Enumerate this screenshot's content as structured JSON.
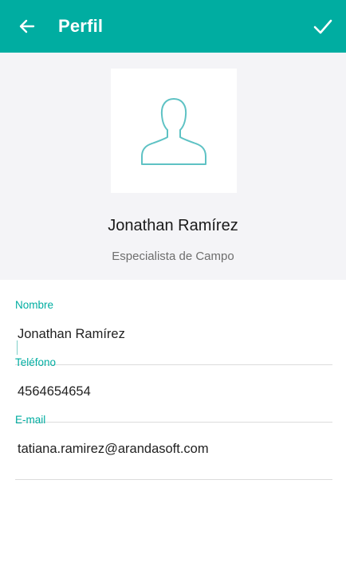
{
  "app_bar": {
    "title": "Perfil",
    "back_icon": "arrow-left-icon",
    "save_icon": "check-icon",
    "color": "#00ADA1"
  },
  "profile": {
    "avatar_icon": "user-silhouette-icon",
    "name": "Jonathan Ramírez",
    "role": "Especialista de Campo"
  },
  "form": {
    "nombre": {
      "label": "Nombre",
      "value": "Jonathan Ramírez"
    },
    "telefono": {
      "label": "Teléfono",
      "value": "4564654654"
    },
    "email": {
      "label": "E-mail",
      "value": "tatiana.ramirez@arandasoft.com"
    }
  }
}
